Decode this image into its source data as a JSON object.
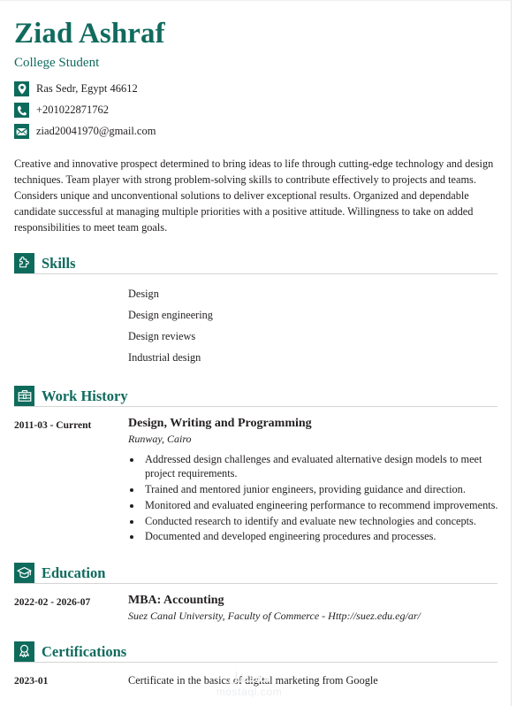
{
  "header": {
    "name": "Ziad Ashraf",
    "subtitle": "College Student",
    "contacts": [
      {
        "icon": "location-pin-icon",
        "text": "Ras Sedr, Egypt 46612"
      },
      {
        "icon": "phone-icon",
        "text": "+201022871762"
      },
      {
        "icon": "envelope-icon",
        "text": "ziad20041970@gmail.com"
      }
    ]
  },
  "summary": {
    "text": "Creative and innovative prospect determined to bring ideas to life through cutting-edge technology and design techniques. Team player with strong problem-solving skills to contribute effectively to projects and teams. Considers unique and unconventional solutions to deliver exceptional results. Organized and dependable candidate successful at managing multiple priorities with a positive attitude. Willingness to take on added responsibilities to meet team goals."
  },
  "sections": {
    "skills": {
      "title": "Skills",
      "icon": "puzzle-piece-icon",
      "items": [
        "Design",
        "Design engineering",
        "Design reviews",
        "Industrial design"
      ]
    },
    "work_history": {
      "title": "Work History",
      "icon": "briefcase-icon",
      "entries": [
        {
          "date": "2011-03 - Current",
          "title": "Design, Writing and Programming",
          "subtitle": "Runway, Cairo",
          "bullets": [
            "Addressed design challenges and evaluated alternative design models to meet project requirements.",
            "Trained and mentored junior engineers, providing guidance and direction.",
            "Monitored and evaluated engineering performance to recommend improvements.",
            "Conducted research to identify and evaluate new technologies and concepts.",
            "Documented and developed engineering procedures and processes."
          ]
        }
      ]
    },
    "education": {
      "title": "Education",
      "icon": "graduation-cap-icon",
      "entries": [
        {
          "date": "2022-02 - 2026-07",
          "title": "MBA: Accounting",
          "subtitle": "Suez Canal University, Faculty of Commerce - Http://suez.edu.eg/ar/"
        }
      ]
    },
    "certifications": {
      "title": "Certifications",
      "icon": "award-ribbon-icon",
      "entries": [
        {
          "date": "2023-01",
          "text": "Certificate in the basics of digital marketing from Google"
        }
      ]
    }
  },
  "watermark": {
    "mark": "مستقل",
    "text": "mostaql.com"
  },
  "colors": {
    "accent": "#0E6B5C",
    "heading": "#106B5E",
    "text": "#231f20",
    "divider": "#d4d4d4"
  }
}
